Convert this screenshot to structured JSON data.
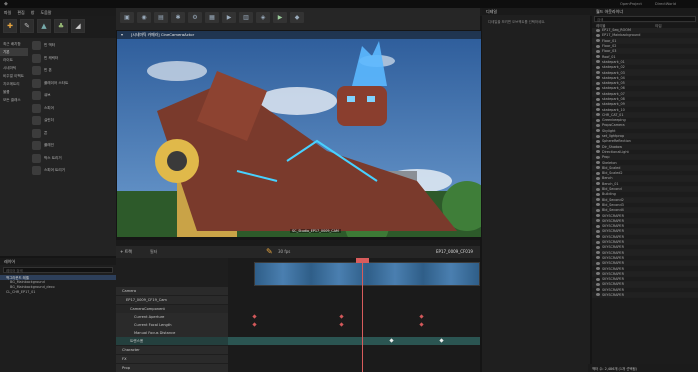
{
  "menu": {
    "items": [
      "파일",
      "편집",
      "창",
      "도움말"
    ]
  },
  "modes": {
    "tabs": [
      "place",
      "paint",
      "landscape",
      "foliage",
      "geometry"
    ]
  },
  "place": {
    "search_placeholder": "클래스 검색",
    "categories": [
      "최근 배치함",
      "기본",
      "라이트",
      "시네마틱",
      "비주얼 이펙트",
      "지오메트리",
      "볼륨",
      "모든 클래스"
    ],
    "selected_category": "기본",
    "items": [
      "빈 액터",
      "빈 캐릭터",
      "빈 폰",
      "플레이어 스타트",
      "큐브",
      "스피어",
      "실린더",
      "콘",
      "플레인",
      "박스 트리거",
      "스피어 트리거"
    ]
  },
  "viewport": {
    "title": "[시네마틱 카메라] CineCameraActor",
    "tag": "SC_Studio_EP17_0009_CAM"
  },
  "sequencer": {
    "sequence_name": "EP17_0009_CF019",
    "filter_label": "필터",
    "add_label": "+ 트랙",
    "fps": "30 fps",
    "tracks": [
      "Camera",
      "EP17_0009_CF19_Cam",
      "CameraComponent",
      "Current Aperture",
      "Current Focal Length",
      "Manual Focus Distance",
      "트랜스폼",
      "Character",
      "FX",
      "Prop"
    ]
  },
  "layers": {
    "title": "레이어",
    "search_placeholder": "레이어 검색",
    "items": [
      "백그라운드 레벨",
      "BG_Mainbackground",
      "BG_Mainbackground_deco",
      "CL_CHR_EP17_01"
    ]
  },
  "outliner": {
    "title": "월드 아웃라이너",
    "search_placeholder": "검색",
    "col_label": "레이블",
    "col_type": "타입",
    "rows": [
      "EP17_Seq_ROOM",
      "EP17_Mainbackground",
      "Floor_01",
      "Floor_02",
      "Floor_03",
      "Roof_01",
      "skatepark_01",
      "skatepark_02",
      "skatepark_03",
      "skatepark_04",
      "skatepark_05",
      "skatepark_06",
      "skatepark_07",
      "skatepark_08",
      "skatepark_09",
      "skatepark_10",
      "CHR_CAT_01",
      "Greenkeeping",
      "PropsCamera",
      "Skylight",
      "set_lightprop",
      "SphereReflection",
      "Dir_Shadow",
      "DirectionalLight",
      "Prop",
      "Skeleton",
      "Bld_Scaled",
      "Bld_Scaled2",
      "Bench",
      "Bench_01",
      "Bld_Second",
      "Building",
      "Bld_Second2",
      "Bld_Second3",
      "Bld_Second4",
      "SKYSCRAPER",
      "SKYSCRAPER",
      "SKYSCRAPER",
      "SKYSCRAPER",
      "SKYSCRAPER",
      "SKYSCRAPER",
      "SKYSCRAPER",
      "SKYSCRAPER",
      "SKYSCRAPER",
      "SKYSCRAPER",
      "SKYSCRAPER",
      "SKYSCRAPER",
      "SKYSCRAPER",
      "SKYSCRAPER",
      "SKYSCRAPER",
      "SKYSCRAPER"
    ],
    "status": "액터 수: 2,486개 (1개 선택됨)"
  },
  "details": {
    "title": "디테일",
    "empty": "디테일을 보려면 오브젝트를 선택하세요."
  },
  "topbar": {
    "project": "OpenProject",
    "window_btn": "DirectWorld"
  }
}
